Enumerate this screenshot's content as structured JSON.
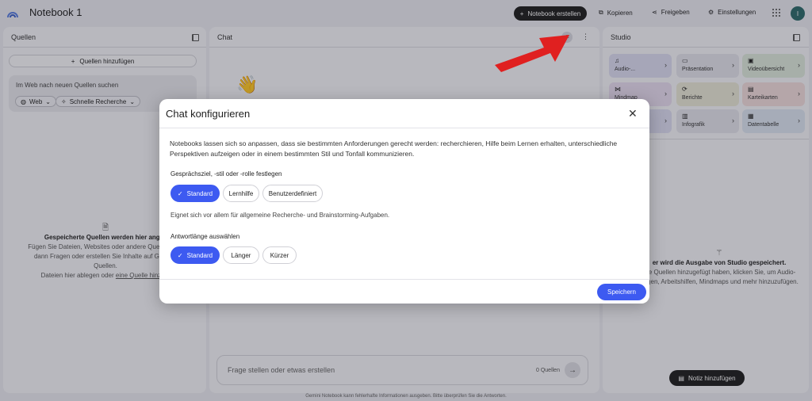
{
  "app": {
    "title": "Notebook 1"
  },
  "topbar": {
    "create_label": "Notebook erstellen",
    "copy_label": "Kopieren",
    "share_label": "Freigeben",
    "settings_label": "Einstellungen",
    "avatar_initial": "I"
  },
  "sources": {
    "title": "Quellen",
    "add_label": "Quellen hinzufügen",
    "search_placeholder": "Im Web nach neuen Quellen suchen",
    "web_chip": "Web",
    "research_chip": "Schnelle Recherche",
    "empty_title": "Gespeicherte Quellen werden hier angez",
    "empty_line1": "Fügen Sie Dateien, Websites oder andere Quellen hinz",
    "empty_line2": "dann Fragen oder erstellen Sie Inhalte auf Grundla",
    "empty_line3": "Quellen.",
    "empty_line4_prefix": "Dateien hier ablegen oder ",
    "empty_line4_link": "eine Quelle hinzufü"
  },
  "chat": {
    "title": "Chat",
    "input_placeholder": "Frage stellen oder etwas erstellen",
    "source_count": "0 Quellen"
  },
  "studio": {
    "title": "Studio",
    "cards": [
      {
        "label": "Audio-..."
      },
      {
        "label": "Präsentation"
      },
      {
        "label": "Videoübersicht"
      },
      {
        "label": "Mindmap"
      },
      {
        "label": "Berichte"
      },
      {
        "label": "Karteikarten"
      },
      {
        "label": ""
      },
      {
        "label": "Infografik"
      },
      {
        "label": "Datentabelle"
      }
    ],
    "empty_title": "er wird die Ausgabe von Studio gespeichert.",
    "empty_line1": "Sie Quellen hinzugefügt haben, klicken Sie, um Audio-",
    "empty_line2": "ungen, Arbeitshilfen, Mindmaps und mehr hinzuzufügen.",
    "note_button": "Notiz hinzufügen"
  },
  "footer": "Gemini Notebook kann fehlerhafte Informationen ausgeben. Bitte überprüfen Sie die Antworten.",
  "modal": {
    "title": "Chat konfigurieren",
    "description": "Notebooks lassen sich so anpassen, dass sie bestimmten Anforderungen gerecht werden: recherchieren, Hilfe beim Lernen erhalten, unterschiedliche Perspektiven aufzeigen oder in einem bestimmten Stil und Tonfall kommunizieren.",
    "goal_label": "Gesprächsziel, -stil oder -rolle festlegen",
    "goal_options": [
      "Standard",
      "Lernhilfe",
      "Benutzerdefiniert"
    ],
    "goal_hint": "Eignet sich vor allem für allgemeine Recherche- und Brainstorming-Aufgaben.",
    "length_label": "Antwortlänge auswählen",
    "length_options": [
      "Standard",
      "Länger",
      "Kürzer"
    ],
    "save_label": "Speichern"
  }
}
